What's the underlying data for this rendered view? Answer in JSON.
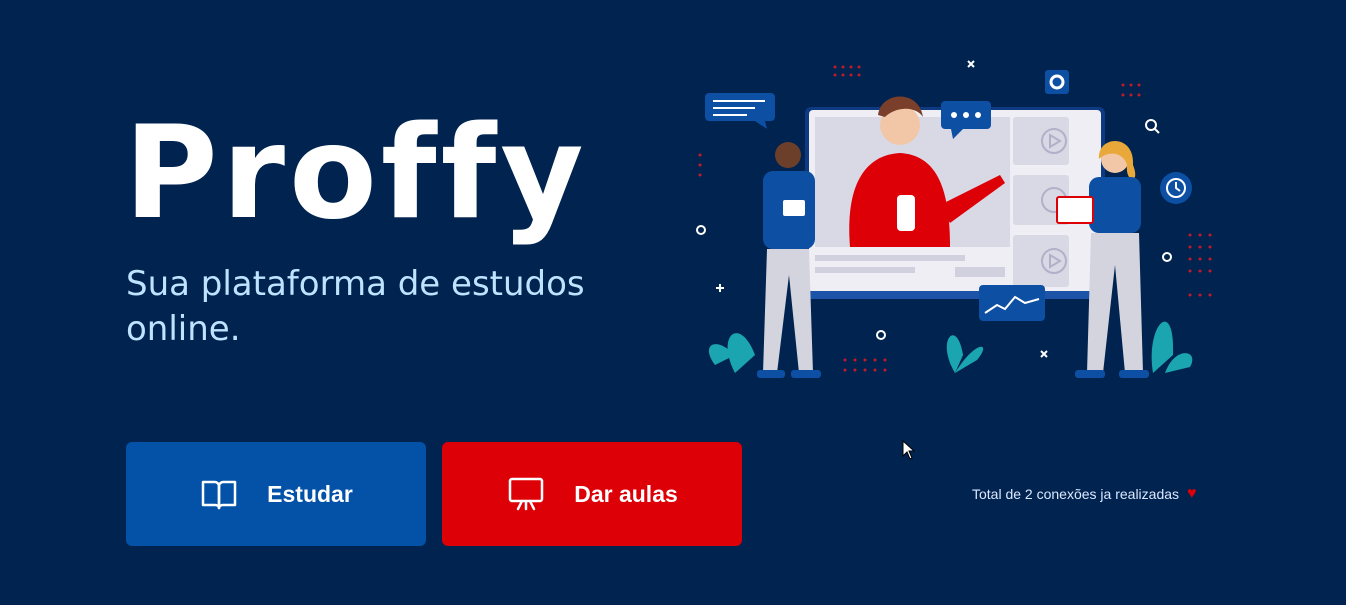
{
  "brand": {
    "logo_text": "Proffy"
  },
  "hero": {
    "tagline": "Sua plataforma de estudos online."
  },
  "buttons": {
    "study": {
      "label": "Estudar",
      "icon": "book-open-icon",
      "color": "#0352a8"
    },
    "teach": {
      "label": "Dar aulas",
      "icon": "presentation-icon",
      "color": "#de0007"
    }
  },
  "footer": {
    "connections_text": "Total de 2 conexões ja realizadas",
    "heart_icon": "heart-icon"
  },
  "colors": {
    "background": "#00234f",
    "accent_blue": "#0352a8",
    "accent_red": "#de0007",
    "tagline": "#bfe3ff"
  }
}
